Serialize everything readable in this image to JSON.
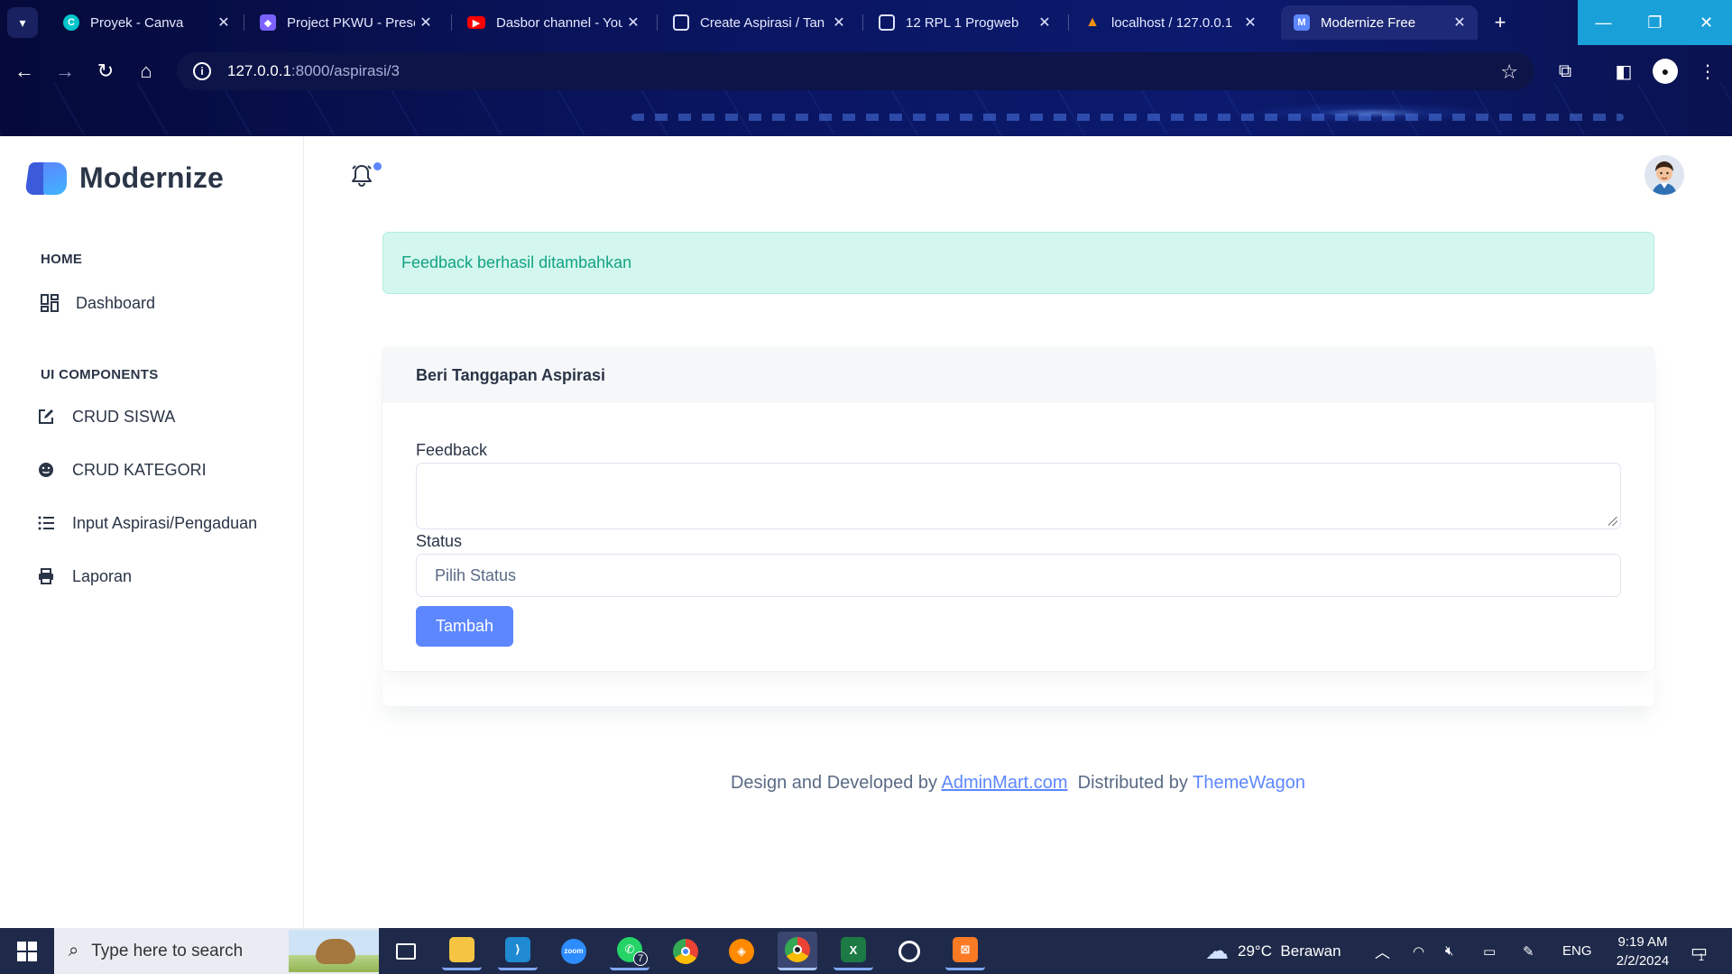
{
  "browser": {
    "tabs": [
      {
        "title": "Proyek - Canva",
        "icon": "canva-icon",
        "color": "#00c4cc"
      },
      {
        "title": "Project PKWU - Prese",
        "icon": "slides-icon",
        "color": "#7b61ff"
      },
      {
        "title": "Dasbor channel - You",
        "icon": "youtube-icon",
        "color": "#ff0000"
      },
      {
        "title": "Create Aspirasi / Tan",
        "icon": "page-icon",
        "color": "#9aa3c7"
      },
      {
        "title": "12 RPL 1 Progweb",
        "icon": "page-icon",
        "color": "#9aa3c7"
      },
      {
        "title": "localhost / 127.0.0.1",
        "icon": "phpmyadmin-icon",
        "color": "#f29111"
      },
      {
        "title": "Modernize Free",
        "icon": "modernize-icon",
        "color": "#5d87ff",
        "active": true
      }
    ],
    "url_host": "127.0.0.1",
    "url_path": ":8000/aspirasi/3"
  },
  "app": {
    "brand": "Modernize",
    "sidebar": {
      "sections": [
        {
          "caption": "HOME",
          "items": [
            {
              "label": "Dashboard",
              "icon": "dashboard-icon"
            }
          ]
        },
        {
          "caption": "UI COMPONENTS",
          "items": [
            {
              "label": "CRUD SISWA",
              "icon": "edit-icon"
            },
            {
              "label": "CRUD KATEGORI",
              "icon": "mood-icon"
            },
            {
              "label": "Input Aspirasi/Pengaduan",
              "icon": "list-icon"
            },
            {
              "label": "Laporan",
              "icon": "printer-icon"
            }
          ]
        }
      ]
    },
    "alert": "Feedback berhasil ditambahkan",
    "form": {
      "title": "Beri Tanggapan Aspirasi",
      "feedback_label": "Feedback",
      "feedback_value": "",
      "status_label": "Status",
      "status_selected": "Pilih Status",
      "submit": "Tambah"
    },
    "footer": {
      "prefix": "Design and Developed by ",
      "link1": "AdminMart.com",
      "middle": "Distributed by ",
      "link2": "ThemeWagon"
    }
  },
  "taskbar": {
    "search_placeholder": "Type here to search",
    "apps": [
      "task-view-icon",
      "file-explorer-icon",
      "vscode-icon",
      "zoom-icon",
      "whatsapp-icon",
      "chrome-icon",
      "brave-icon",
      "chrome-profile-icon",
      "excel-icon",
      "obs-icon",
      "xampp-icon"
    ],
    "whatsapp_badge": "7",
    "weather": "29°C  Berawan",
    "language": "ENG",
    "time": "9:19 AM",
    "date": "2/2/2024",
    "notification_count": "1"
  }
}
